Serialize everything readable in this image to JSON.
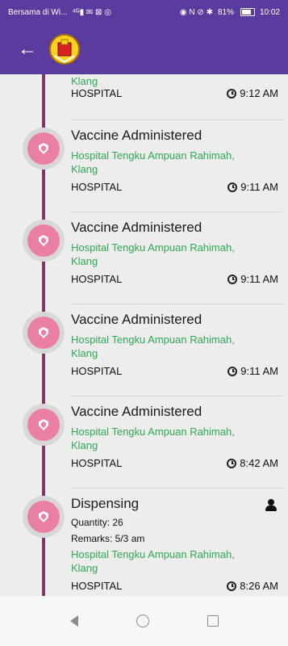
{
  "status_bar": {
    "carrier_text": "Bersama di Wi...",
    "battery_percent": "81%",
    "time": "10:02",
    "left_icons_text": "⁴ᴳ▮ ✉ ⊠ ◎",
    "right_icons_text": "◉ N ⊘ ✱"
  },
  "items": [
    {
      "title": "",
      "location": "Klang",
      "category": "HOSPITAL",
      "time": "9:12 AM"
    },
    {
      "title": "Vaccine Administered",
      "location": "Hospital Tengku Ampuan Rahimah, Klang",
      "category": "HOSPITAL",
      "time": "9:11 AM"
    },
    {
      "title": "Vaccine Administered",
      "location": "Hospital Tengku Ampuan Rahimah, Klang",
      "category": "HOSPITAL",
      "time": "9:11 AM"
    },
    {
      "title": "Vaccine Administered",
      "location": "Hospital Tengku Ampuan Rahimah, Klang",
      "category": "HOSPITAL",
      "time": "9:11 AM"
    },
    {
      "title": "Vaccine Administered",
      "location": "Hospital Tengku Ampuan Rahimah, Klang",
      "category": "HOSPITAL",
      "time": "8:42 AM"
    },
    {
      "title": "Dispensing",
      "quantity": "Quantity: 26",
      "remarks": "Remarks: 5/3 am",
      "location": "Hospital Tengku Ampuan Rahimah, Klang",
      "category": "HOSPITAL",
      "time": "8:26 AM"
    }
  ],
  "colors": {
    "header": "#5b3b9e",
    "timeline_line": "#7a3b67",
    "timeline_dot": "#ea7fa6",
    "location_text": "#2eaa52"
  },
  "icons": {
    "back": "arrow-left-icon",
    "logo": "coat-of-arms-logo",
    "timeline": "timeline-badge-icon",
    "clock": "clock-icon",
    "person": "person-icon"
  }
}
